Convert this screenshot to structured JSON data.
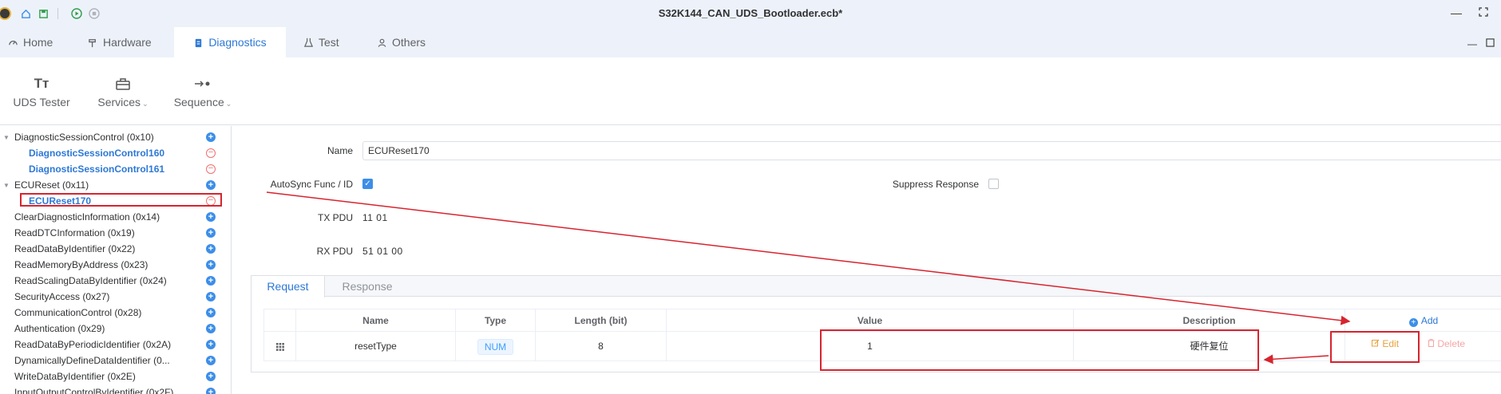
{
  "window": {
    "title": "S32K144_CAN_UDS_Bootloader.ecb*"
  },
  "tabs": [
    {
      "label": "Home"
    },
    {
      "label": "Hardware"
    },
    {
      "label": "Diagnostics"
    },
    {
      "label": "Test"
    },
    {
      "label": "Others"
    }
  ],
  "ribbon": {
    "uds_tester": "UDS Tester",
    "services": "Services",
    "sequence": "Sequence"
  },
  "tree": [
    {
      "label": "DiagnosticSessionControl (0x10)",
      "level": 0
    },
    {
      "label": "DiagnosticSessionControl160",
      "level": 1
    },
    {
      "label": "DiagnosticSessionControl161",
      "level": 1
    },
    {
      "label": "ECUReset (0x11)",
      "level": 0
    },
    {
      "label": "ECUReset170",
      "level": 1
    },
    {
      "label": "ClearDiagnosticInformation (0x14)",
      "level": 0
    },
    {
      "label": "ReadDTCInformation (0x19)",
      "level": 0
    },
    {
      "label": "ReadDataByIdentifier (0x22)",
      "level": 0
    },
    {
      "label": "ReadMemoryByAddress (0x23)",
      "level": 0
    },
    {
      "label": "ReadScalingDataByIdentifier (0x24)",
      "level": 0
    },
    {
      "label": "SecurityAccess (0x27)",
      "level": 0
    },
    {
      "label": "CommunicationControl (0x28)",
      "level": 0
    },
    {
      "label": "Authentication (0x29)",
      "level": 0
    },
    {
      "label": "ReadDataByPeriodicIdentifier (0x2A)",
      "level": 0
    },
    {
      "label": "DynamicallyDefineDataIdentifier (0...",
      "level": 0
    },
    {
      "label": "WriteDataByIdentifier (0x2E)",
      "level": 0
    },
    {
      "label": "InputOutputControlByIdentifier (0x2F)",
      "level": 0
    }
  ],
  "form": {
    "name_label": "Name",
    "name_value": "ECUReset170",
    "autosync_label": "AutoSync Func / ID",
    "autosync_checked": true,
    "suppress_label": "Suppress Response",
    "suppress_checked": false,
    "tx_label": "TX PDU",
    "tx_bytes": "11 01",
    "rx_label": "RX PDU",
    "rx_bytes": "51 01 00"
  },
  "subtabs": {
    "request": "Request",
    "response": "Response"
  },
  "table": {
    "headers": {
      "name": "Name",
      "type": "Type",
      "length": "Length (bit)",
      "value": "Value",
      "description": "Description",
      "add": "Add"
    },
    "rows": [
      {
        "name": "resetType",
        "type": "NUM",
        "length": "8",
        "value": "1",
        "description": "硬件复位",
        "edit": "Edit",
        "delete": "Delete"
      }
    ]
  },
  "colors": {
    "accent": "#2d78d6",
    "annotation": "#d7242f",
    "titlebar_bg": "#edf2fa",
    "edit": "#e6a23c",
    "delete": "#f6a6a6"
  }
}
